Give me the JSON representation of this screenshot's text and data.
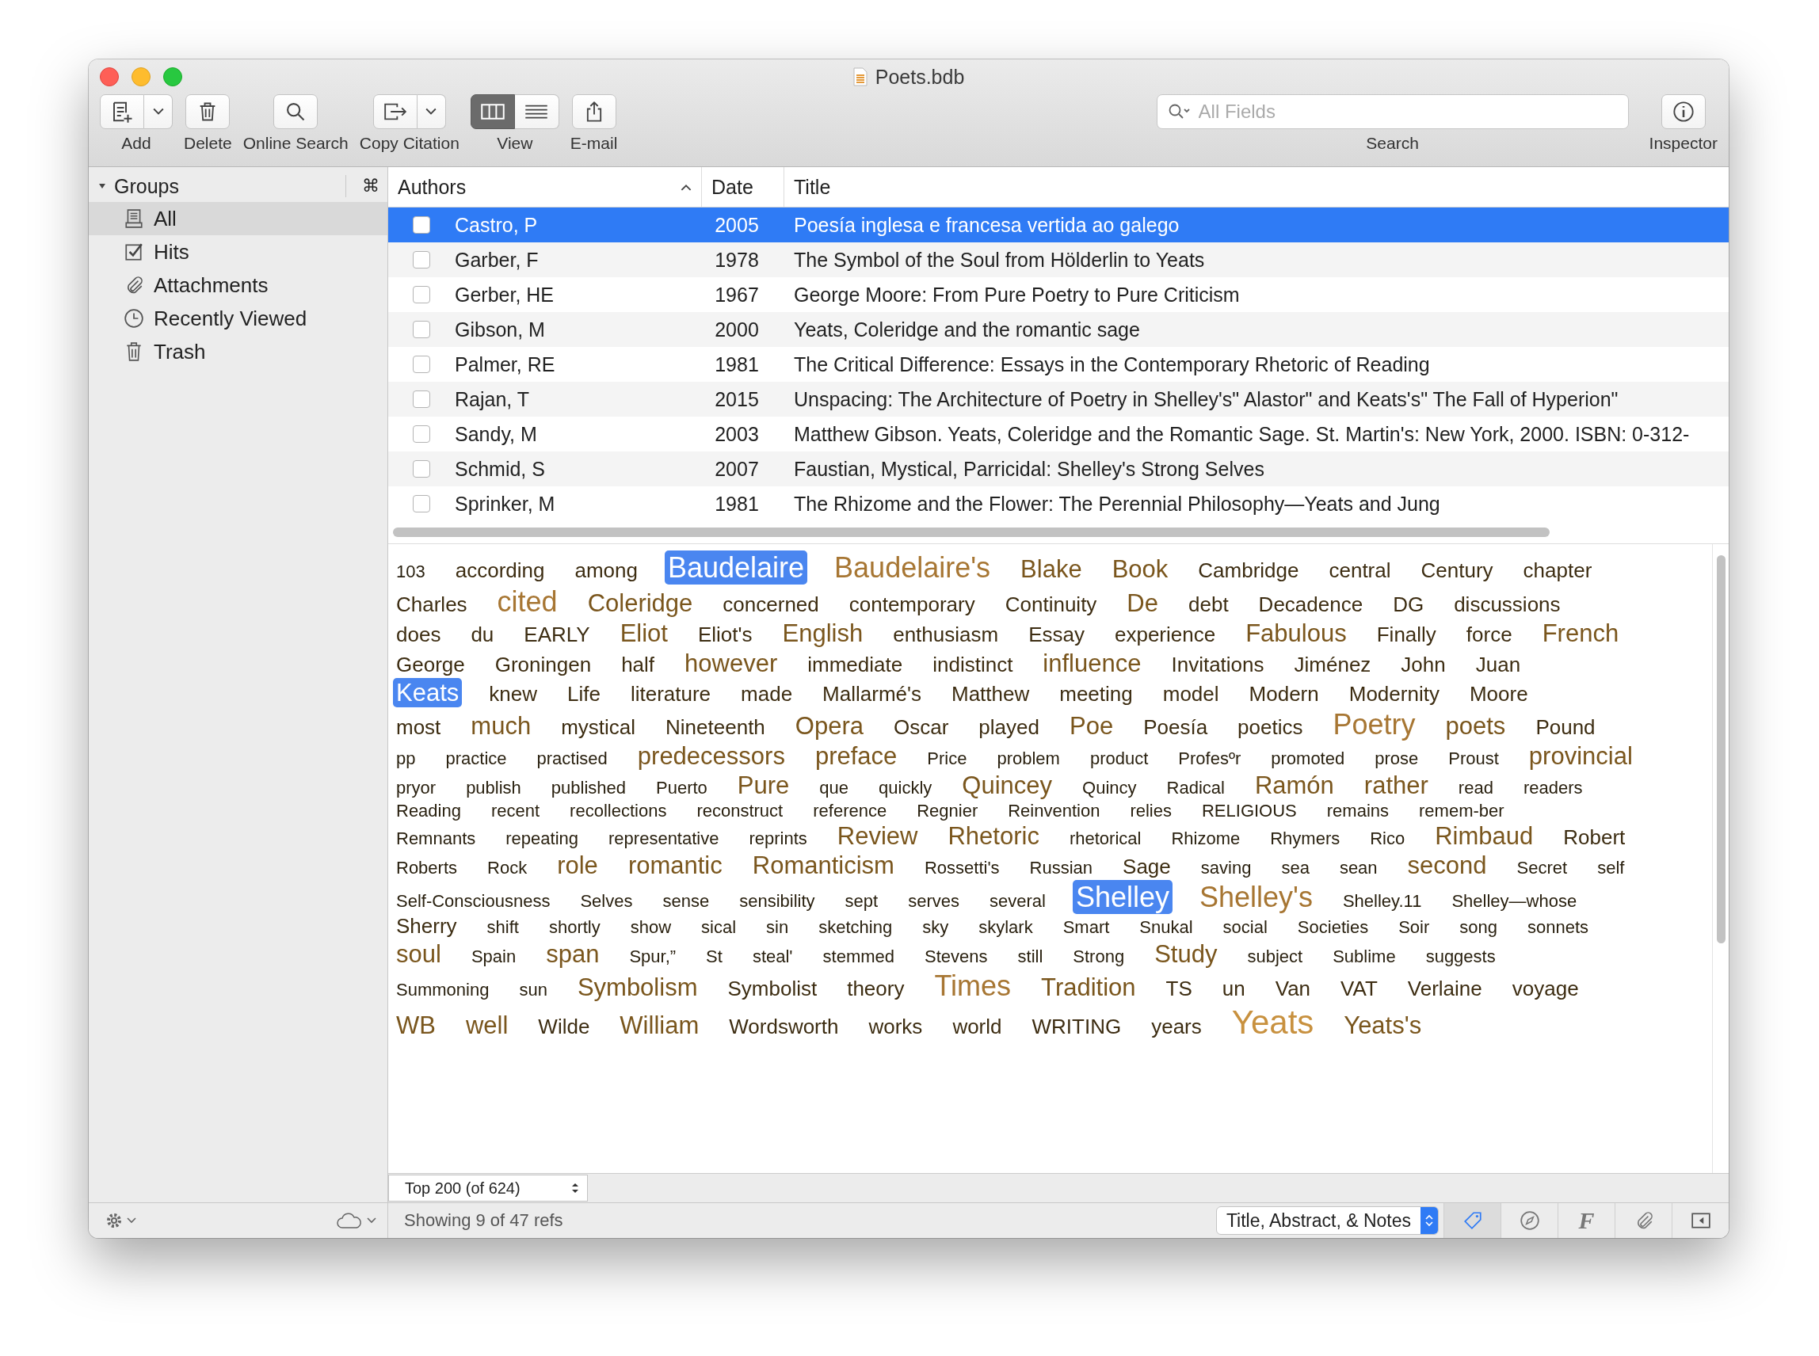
{
  "window": {
    "title": "Poets.bdb"
  },
  "toolbar": {
    "add": {
      "label": "Add"
    },
    "delete": {
      "label": "Delete"
    },
    "online_search": {
      "label": "Online Search"
    },
    "copy_citation": {
      "label": "Copy Citation"
    },
    "view": {
      "label": "View",
      "segments": [
        {
          "kind": "columns",
          "selected": true
        },
        {
          "kind": "list",
          "selected": false
        }
      ]
    },
    "email": {
      "label": "E-mail"
    },
    "search": {
      "placeholder": "All Fields",
      "label": "Search"
    },
    "inspector": {
      "label": "Inspector"
    }
  },
  "sidebar": {
    "header": {
      "label": "Groups",
      "expanded": true,
      "shortcut": "⌘"
    },
    "items": [
      {
        "kind": "library",
        "label": "All",
        "selected": true
      },
      {
        "kind": "checklist",
        "label": "Hits",
        "selected": false
      },
      {
        "kind": "attachment",
        "label": "Attachments",
        "selected": false
      },
      {
        "kind": "clock",
        "label": "Recently Viewed",
        "selected": false
      },
      {
        "kind": "trash",
        "label": "Trash",
        "selected": false
      }
    ]
  },
  "table": {
    "columns": [
      {
        "label": "Authors",
        "sorted": true
      },
      {
        "label": "Date",
        "sorted": false
      },
      {
        "label": "Title",
        "sorted": false
      }
    ],
    "rows": [
      {
        "checked": false,
        "selected": true,
        "author": "Castro, P",
        "date": "2005",
        "title": "Poesía inglesa e francesa vertida ao galego"
      },
      {
        "checked": false,
        "selected": false,
        "author": "Garber, F",
        "date": "1978",
        "title": "The Symbol of the Soul from Hölderlin to Yeats"
      },
      {
        "checked": false,
        "selected": false,
        "author": "Gerber, HE",
        "date": "1967",
        "title": "George Moore: From Pure Poetry to Pure Criticism"
      },
      {
        "checked": false,
        "selected": false,
        "author": "Gibson, M",
        "date": "2000",
        "title": "Yeats, Coleridge and the romantic sage"
      },
      {
        "checked": false,
        "selected": false,
        "author": "Palmer, RE",
        "date": "1981",
        "title": "The Critical Difference: Essays in the Contemporary Rhetoric of Reading"
      },
      {
        "checked": false,
        "selected": false,
        "author": "Rajan, T",
        "date": "2015",
        "title": "Unspacing: The Architecture of Poetry in Shelley's\" Alastor\" and Keats's\" The Fall of Hyperion\""
      },
      {
        "checked": false,
        "selected": false,
        "author": "Sandy, M",
        "date": "2003",
        "title": "Matthew Gibson. Yeats, Coleridge and the Romantic Sage. St. Martin's: New York, 2000. ISBN: 0-312-"
      },
      {
        "checked": false,
        "selected": false,
        "author": "Schmid, S",
        "date": "2007",
        "title": "Faustian, Mystical, Parricidal: Shelley's Strong Selves"
      },
      {
        "checked": false,
        "selected": false,
        "author": "Sprinker, M",
        "date": "1981",
        "title": "The Rhizome and the Flower: The Perennial Philosophy—Yeats and Jung"
      }
    ]
  },
  "word_cloud": {
    "rows": [
      {
        "words": [
          {
            "text": "103",
            "kind": "small",
            "selected": false
          },
          {
            "text": "according",
            "kind": "medium",
            "selected": false
          },
          {
            "text": "among",
            "kind": "medium",
            "selected": false
          },
          {
            "text": "Baudelaire",
            "kind": "xlarge",
            "selected": true
          },
          {
            "text": "Baudelaire's",
            "kind": "xlarge",
            "selected": false
          },
          {
            "text": "Blake",
            "kind": "large",
            "selected": false
          },
          {
            "text": "Book",
            "kind": "large",
            "selected": false
          },
          {
            "text": "Cambridge",
            "kind": "medium",
            "selected": false
          },
          {
            "text": "central",
            "kind": "medium",
            "selected": false
          },
          {
            "text": "Century",
            "kind": "medium",
            "selected": false
          },
          {
            "text": "chapter",
            "kind": "medium",
            "selected": false
          }
        ]
      },
      {
        "words": [
          {
            "text": "Charles",
            "kind": "medium",
            "selected": false
          },
          {
            "text": "cited",
            "kind": "xlarge",
            "selected": false
          },
          {
            "text": "Coleridge",
            "kind": "large",
            "selected": false
          },
          {
            "text": "concerned",
            "kind": "medium",
            "selected": false
          },
          {
            "text": "contemporary",
            "kind": "medium",
            "selected": false
          },
          {
            "text": "Continuity",
            "kind": "medium",
            "selected": false
          },
          {
            "text": "De",
            "kind": "large",
            "selected": false
          },
          {
            "text": "debt",
            "kind": "medium",
            "selected": false
          },
          {
            "text": "Decadence",
            "kind": "medium",
            "selected": false
          },
          {
            "text": "DG",
            "kind": "medium",
            "selected": false
          },
          {
            "text": "discussions",
            "kind": "medium",
            "selected": false
          }
        ]
      },
      {
        "words": [
          {
            "text": "does",
            "kind": "medium",
            "selected": false
          },
          {
            "text": "du",
            "kind": "medium",
            "selected": false
          },
          {
            "text": "EARLY",
            "kind": "medium",
            "selected": false
          },
          {
            "text": "Eliot",
            "kind": "large",
            "selected": false
          },
          {
            "text": "Eliot's",
            "kind": "medium",
            "selected": false
          },
          {
            "text": "English",
            "kind": "large",
            "selected": false
          },
          {
            "text": "enthusiasm",
            "kind": "medium",
            "selected": false
          },
          {
            "text": "Essay",
            "kind": "medium",
            "selected": false
          },
          {
            "text": "experience",
            "kind": "medium",
            "selected": false
          },
          {
            "text": "Fabulous",
            "kind": "large",
            "selected": false
          },
          {
            "text": "Finally",
            "kind": "medium",
            "selected": false
          },
          {
            "text": "force",
            "kind": "medium",
            "selected": false
          },
          {
            "text": "French",
            "kind": "large",
            "selected": false
          }
        ]
      },
      {
        "words": [
          {
            "text": "George",
            "kind": "medium",
            "selected": false
          },
          {
            "text": "Groningen",
            "kind": "medium",
            "selected": false
          },
          {
            "text": "half",
            "kind": "medium",
            "selected": false
          },
          {
            "text": "however",
            "kind": "large",
            "selected": false
          },
          {
            "text": "immediate",
            "kind": "medium",
            "selected": false
          },
          {
            "text": "indistinct",
            "kind": "medium",
            "selected": false
          },
          {
            "text": "influence",
            "kind": "large",
            "selected": false
          },
          {
            "text": "Invitations",
            "kind": "medium",
            "selected": false
          },
          {
            "text": "Jiménez",
            "kind": "medium",
            "selected": false
          },
          {
            "text": "John",
            "kind": "medium",
            "selected": false
          },
          {
            "text": "Juan",
            "kind": "medium",
            "selected": false
          }
        ]
      },
      {
        "words": [
          {
            "text": "Keats",
            "kind": "large",
            "selected": true
          },
          {
            "text": "knew",
            "kind": "medium",
            "selected": false
          },
          {
            "text": "Life",
            "kind": "medium",
            "selected": false
          },
          {
            "text": "literature",
            "kind": "medium",
            "selected": false
          },
          {
            "text": "made",
            "kind": "medium",
            "selected": false
          },
          {
            "text": "Mallarmé's",
            "kind": "medium",
            "selected": false
          },
          {
            "text": "Matthew",
            "kind": "medium",
            "selected": false
          },
          {
            "text": "meeting",
            "kind": "medium",
            "selected": false
          },
          {
            "text": "model",
            "kind": "medium",
            "selected": false
          },
          {
            "text": "Modern",
            "kind": "medium",
            "selected": false
          },
          {
            "text": "Modernity",
            "kind": "medium",
            "selected": false
          },
          {
            "text": "Moore",
            "kind": "medium",
            "selected": false
          }
        ]
      },
      {
        "words": [
          {
            "text": "most",
            "kind": "medium",
            "selected": false
          },
          {
            "text": "much",
            "kind": "large",
            "selected": false
          },
          {
            "text": "mystical",
            "kind": "medium",
            "selected": false
          },
          {
            "text": "Nineteenth",
            "kind": "medium",
            "selected": false
          },
          {
            "text": "Opera",
            "kind": "large",
            "selected": false
          },
          {
            "text": "Oscar",
            "kind": "medium",
            "selected": false
          },
          {
            "text": "played",
            "kind": "medium",
            "selected": false
          },
          {
            "text": "Poe",
            "kind": "large",
            "selected": false
          },
          {
            "text": "Poesía",
            "kind": "medium",
            "selected": false
          },
          {
            "text": "poetics",
            "kind": "medium",
            "selected": false
          },
          {
            "text": "Poetry",
            "kind": "xlarge",
            "selected": false
          },
          {
            "text": "poets",
            "kind": "large",
            "selected": false
          },
          {
            "text": "Pound",
            "kind": "medium",
            "selected": false
          }
        ]
      },
      {
        "words": [
          {
            "text": "pp",
            "kind": "small",
            "selected": false
          },
          {
            "text": "practice",
            "kind": "small",
            "selected": false
          },
          {
            "text": "practised",
            "kind": "small",
            "selected": false
          },
          {
            "text": "predecessors",
            "kind": "large",
            "selected": false
          },
          {
            "text": "preface",
            "kind": "large",
            "selected": false
          },
          {
            "text": "Price",
            "kind": "small",
            "selected": false
          },
          {
            "text": "problem",
            "kind": "small",
            "selected": false
          },
          {
            "text": "product",
            "kind": "small",
            "selected": false
          },
          {
            "text": "Profesºr",
            "kind": "small",
            "selected": false
          },
          {
            "text": "promoted",
            "kind": "small",
            "selected": false
          },
          {
            "text": "prose",
            "kind": "small",
            "selected": false
          },
          {
            "text": "Proust",
            "kind": "small",
            "selected": false
          },
          {
            "text": "provincial",
            "kind": "large",
            "selected": false
          }
        ]
      },
      {
        "words": [
          {
            "text": "pryor",
            "kind": "small",
            "selected": false
          },
          {
            "text": "publish",
            "kind": "small",
            "selected": false
          },
          {
            "text": "published",
            "kind": "small",
            "selected": false
          },
          {
            "text": "Puerto",
            "kind": "small",
            "selected": false
          },
          {
            "text": "Pure",
            "kind": "large",
            "selected": false
          },
          {
            "text": "que",
            "kind": "small",
            "selected": false
          },
          {
            "text": "quickly",
            "kind": "small",
            "selected": false
          },
          {
            "text": "Quincey",
            "kind": "large",
            "selected": false
          },
          {
            "text": "Quincy",
            "kind": "small",
            "selected": false
          },
          {
            "text": "Radical",
            "kind": "small",
            "selected": false
          },
          {
            "text": "Ramón",
            "kind": "large",
            "selected": false
          },
          {
            "text": "rather",
            "kind": "large",
            "selected": false
          },
          {
            "text": "read",
            "kind": "small",
            "selected": false
          },
          {
            "text": "readers",
            "kind": "small",
            "selected": false
          }
        ]
      },
      {
        "words": [
          {
            "text": "Reading",
            "kind": "small",
            "selected": false
          },
          {
            "text": "recent",
            "kind": "small",
            "selected": false
          },
          {
            "text": "recollections",
            "kind": "small",
            "selected": false
          },
          {
            "text": "reconstruct",
            "kind": "small",
            "selected": false
          },
          {
            "text": "reference",
            "kind": "small",
            "selected": false
          },
          {
            "text": "Regnier",
            "kind": "small",
            "selected": false
          },
          {
            "text": "Reinvention",
            "kind": "small",
            "selected": false
          },
          {
            "text": "relies",
            "kind": "small",
            "selected": false
          },
          {
            "text": "RELIGIOUS",
            "kind": "small",
            "selected": false
          },
          {
            "text": "remains",
            "kind": "small",
            "selected": false
          },
          {
            "text": "remem-ber",
            "kind": "small",
            "selected": false
          }
        ]
      },
      {
        "words": [
          {
            "text": "Remnants",
            "kind": "small",
            "selected": false
          },
          {
            "text": "repeating",
            "kind": "small",
            "selected": false
          },
          {
            "text": "representative",
            "kind": "small",
            "selected": false
          },
          {
            "text": "reprints",
            "kind": "small",
            "selected": false
          },
          {
            "text": "Review",
            "kind": "large",
            "selected": false
          },
          {
            "text": "Rhetoric",
            "kind": "large",
            "selected": false
          },
          {
            "text": "rhetorical",
            "kind": "small",
            "selected": false
          },
          {
            "text": "Rhizome",
            "kind": "small",
            "selected": false
          },
          {
            "text": "Rhymers",
            "kind": "small",
            "selected": false
          },
          {
            "text": "Rico",
            "kind": "small",
            "selected": false
          },
          {
            "text": "Rimbaud",
            "kind": "large",
            "selected": false
          },
          {
            "text": "Robert",
            "kind": "medium",
            "selected": false
          }
        ]
      },
      {
        "words": [
          {
            "text": "Roberts",
            "kind": "small",
            "selected": false
          },
          {
            "text": "Rock",
            "kind": "small",
            "selected": false
          },
          {
            "text": "role",
            "kind": "large",
            "selected": false
          },
          {
            "text": "romantic",
            "kind": "large",
            "selected": false
          },
          {
            "text": "Romanticism",
            "kind": "large",
            "selected": false
          },
          {
            "text": "Rossetti's",
            "kind": "small",
            "selected": false
          },
          {
            "text": "Russian",
            "kind": "small",
            "selected": false
          },
          {
            "text": "Sage",
            "kind": "medium",
            "selected": false
          },
          {
            "text": "saving",
            "kind": "small",
            "selected": false
          },
          {
            "text": "sea",
            "kind": "small",
            "selected": false
          },
          {
            "text": "sean",
            "kind": "small",
            "selected": false
          },
          {
            "text": "second",
            "kind": "large",
            "selected": false
          },
          {
            "text": "Secret",
            "kind": "small",
            "selected": false
          },
          {
            "text": "self",
            "kind": "small",
            "selected": false
          }
        ]
      },
      {
        "words": [
          {
            "text": "Self-Consciousness",
            "kind": "small",
            "selected": false
          },
          {
            "text": "Selves",
            "kind": "small",
            "selected": false
          },
          {
            "text": "sense",
            "kind": "small",
            "selected": false
          },
          {
            "text": "sensibility",
            "kind": "small",
            "selected": false
          },
          {
            "text": "sept",
            "kind": "small",
            "selected": false
          },
          {
            "text": "serves",
            "kind": "small",
            "selected": false
          },
          {
            "text": "several",
            "kind": "small",
            "selected": false
          },
          {
            "text": "Shelley",
            "kind": "xlarge",
            "selected": true
          },
          {
            "text": "Shelley's",
            "kind": "xlarge",
            "selected": false
          },
          {
            "text": "Shelley.11",
            "kind": "small",
            "selected": false
          },
          {
            "text": "Shelley—whose",
            "kind": "small",
            "selected": false
          }
        ]
      },
      {
        "words": [
          {
            "text": "Sherry",
            "kind": "medium",
            "selected": false
          },
          {
            "text": "shift",
            "kind": "small",
            "selected": false
          },
          {
            "text": "shortly",
            "kind": "small",
            "selected": false
          },
          {
            "text": "show",
            "kind": "small",
            "selected": false
          },
          {
            "text": "sical",
            "kind": "small",
            "selected": false
          },
          {
            "text": "sin",
            "kind": "small",
            "selected": false
          },
          {
            "text": "sketching",
            "kind": "small",
            "selected": false
          },
          {
            "text": "sky",
            "kind": "small",
            "selected": false
          },
          {
            "text": "skylark",
            "kind": "small",
            "selected": false
          },
          {
            "text": "Smart",
            "kind": "small",
            "selected": false
          },
          {
            "text": "Snukal",
            "kind": "small",
            "selected": false
          },
          {
            "text": "social",
            "kind": "small",
            "selected": false
          },
          {
            "text": "Societies",
            "kind": "small",
            "selected": false
          },
          {
            "text": "Soir",
            "kind": "small",
            "selected": false
          },
          {
            "text": "song",
            "kind": "small",
            "selected": false
          },
          {
            "text": "sonnets",
            "kind": "small",
            "selected": false
          }
        ]
      },
      {
        "words": [
          {
            "text": "soul",
            "kind": "large",
            "selected": false
          },
          {
            "text": "Spain",
            "kind": "small",
            "selected": false
          },
          {
            "text": "span",
            "kind": "large",
            "selected": false
          },
          {
            "text": "Spur,”",
            "kind": "small",
            "selected": false
          },
          {
            "text": "St",
            "kind": "small",
            "selected": false
          },
          {
            "text": "steal'",
            "kind": "small",
            "selected": false
          },
          {
            "text": "stemmed",
            "kind": "small",
            "selected": false
          },
          {
            "text": "Stevens",
            "kind": "small",
            "selected": false
          },
          {
            "text": "still",
            "kind": "small",
            "selected": false
          },
          {
            "text": "Strong",
            "kind": "small",
            "selected": false
          },
          {
            "text": "Study",
            "kind": "large",
            "selected": false
          },
          {
            "text": "subject",
            "kind": "small",
            "selected": false
          },
          {
            "text": "Sublime",
            "kind": "small",
            "selected": false
          },
          {
            "text": "suggests",
            "kind": "small",
            "selected": false
          }
        ]
      },
      {
        "words": [
          {
            "text": "Summoning",
            "kind": "small",
            "selected": false
          },
          {
            "text": "sun",
            "kind": "small",
            "selected": false
          },
          {
            "text": "Symbolism",
            "kind": "large",
            "selected": false
          },
          {
            "text": "Symbolist",
            "kind": "medium",
            "selected": false
          },
          {
            "text": "theory",
            "kind": "medium",
            "selected": false
          },
          {
            "text": "Times",
            "kind": "xlarge",
            "selected": false
          },
          {
            "text": "Tradition",
            "kind": "large",
            "selected": false
          },
          {
            "text": "TS",
            "kind": "medium",
            "selected": false
          },
          {
            "text": "un",
            "kind": "medium",
            "selected": false
          },
          {
            "text": "Van",
            "kind": "medium",
            "selected": false
          },
          {
            "text": "VAT",
            "kind": "medium",
            "selected": false
          },
          {
            "text": "Verlaine",
            "kind": "medium",
            "selected": false
          },
          {
            "text": "voyage",
            "kind": "medium",
            "selected": false
          }
        ]
      },
      {
        "words": [
          {
            "text": "WB",
            "kind": "large",
            "selected": false
          },
          {
            "text": "well",
            "kind": "large",
            "selected": false
          },
          {
            "text": "Wilde",
            "kind": "medium",
            "selected": false
          },
          {
            "text": "William",
            "kind": "large",
            "selected": false
          },
          {
            "text": "Wordsworth",
            "kind": "medium",
            "selected": false
          },
          {
            "text": "works",
            "kind": "medium",
            "selected": false
          },
          {
            "text": "world",
            "kind": "medium",
            "selected": false
          },
          {
            "text": "WRITING",
            "kind": "medium",
            "selected": false
          },
          {
            "text": "years",
            "kind": "medium",
            "selected": false
          },
          {
            "text": "Yeats",
            "kind": "xxlarge",
            "selected": false
          },
          {
            "text": "Yeats's",
            "kind": "large",
            "selected": false
          }
        ]
      }
    ],
    "limit_selector": "Top 200 (of 624)"
  },
  "status_bar": {
    "summary": "Showing 9 of 47 refs",
    "field_selector": "Title, Abstract, & Notes",
    "tools": [
      {
        "kind": "tag",
        "selected": true
      },
      {
        "kind": "compass",
        "selected": false
      },
      {
        "kind": "font",
        "label": "F",
        "selected": false
      },
      {
        "kind": "attachment",
        "selected": false
      },
      {
        "kind": "panel",
        "selected": false
      }
    ]
  }
}
